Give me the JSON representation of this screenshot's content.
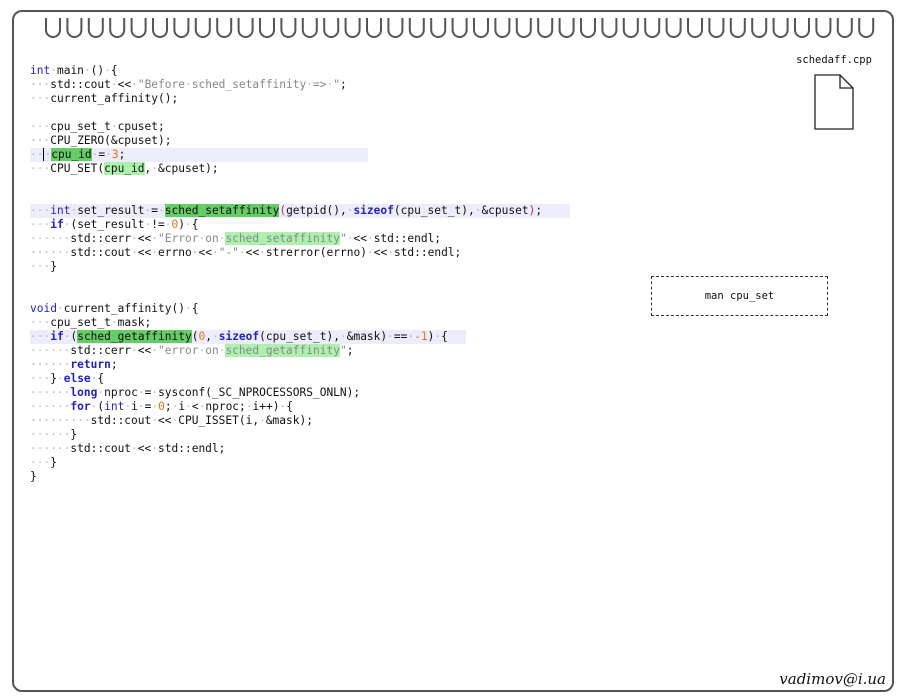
{
  "file": {
    "name": "schedaff.cpp",
    "icon": "document-icon"
  },
  "man_box": {
    "label": "man cpu_set"
  },
  "signature": "vadimov@i.ua",
  "colors": {
    "highlight_line": "#ececfb",
    "func_highlight": "#66cc66",
    "keyword": "#2323b8",
    "number": "#e07a1a"
  }
}
